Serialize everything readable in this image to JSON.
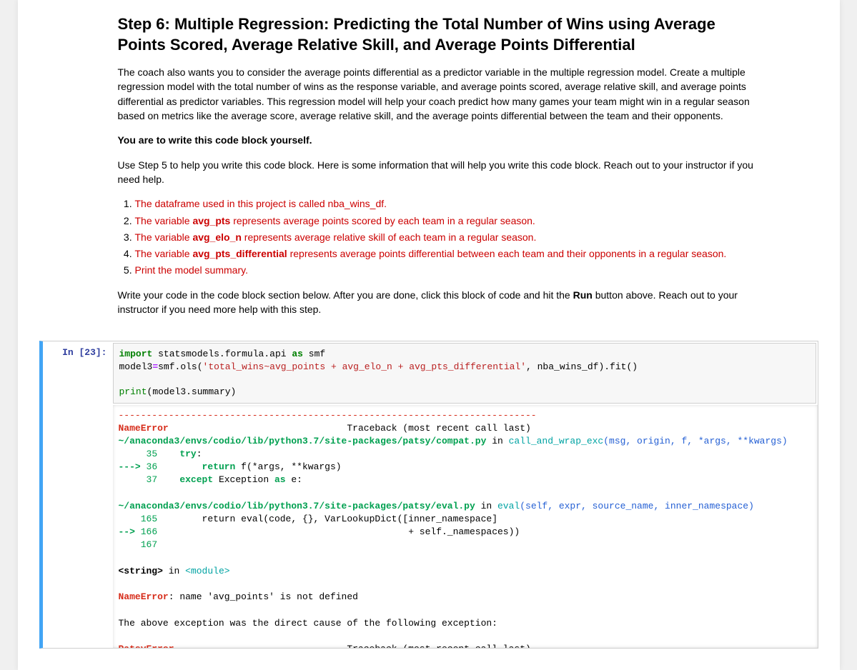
{
  "heading": "Step 6: Multiple Regression: Predicting the Total Number of Wins using Average Points Scored, Average Relative Skill, and Average Points Differential",
  "para1": "The coach also wants you to consider the average points differential as a predictor variable in the multiple regression model. Create a multiple regression model with the total number of wins as the response variable, and average points scored, average relative skill, and average points differential as predictor variables. This regression model will help your coach predict how many games your team might win in a regular season based on metrics like the average score, average relative skill, and the average points differential between the team and their opponents.",
  "para2_bold": "You are to write this code block yourself.",
  "para3": "Use Step 5 to help you write this code block. Here is some information that will help you write this code block. Reach out to your instructor if you need help.",
  "list": {
    "i1": "The dataframe used in this project is called nba_wins_df.",
    "i2a": "The variable ",
    "i2b": "avg_pts",
    "i2c": " represents average points scored by each team in a regular season.",
    "i3a": "The variable ",
    "i3b": "avg_elo_n",
    "i3c": " represents average relative skill of each team in a regular season.",
    "i4a": "The variable ",
    "i4b": "avg_pts_differential",
    "i4c": " represents average points differential between each team and their opponents in a regular season.",
    "i5": "Print the model summary."
  },
  "para4a": "Write your code in the code block section below. After you are done, click this block of code and hit the ",
  "para4b": "Run",
  "para4c": " button above. Reach out to your instructor if you need more help with this step.",
  "cell": {
    "prompt": "In [23]:",
    "code": {
      "l1_import": "import",
      "l1_mod": " statsmodels.formula.api ",
      "l1_as": "as",
      "l1_alias": " smf",
      "l2_a": "model3",
      "l2_eq": "=",
      "l2_b": "smf.ols(",
      "l2_str": "'total_wins~avg_points + avg_elo_n + avg_pts_differential'",
      "l2_c": ", nba_wins_df).fit()",
      "l3_blank": "",
      "l4_print": "print",
      "l4_open": "(",
      "l4_arg": "model3.summary",
      "l4_close": ")"
    },
    "traceback": {
      "rule": "---------------------------------------------------------------------------",
      "name_error": "NameError",
      "trace_label": "                                Traceback (most recent call last)",
      "file1": "~/anaconda3/envs/codio/lib/python3.7/site-packages/patsy/compat.py",
      "in1": " in ",
      "fn1": "call_and_wrap_exc",
      "sig1": "(msg, origin, f, *args, **kwargs)",
      "l35_num": "     35",
      "l35_try": "    try",
      "l35_colon": ":",
      "l36_arrow": "---> ",
      "l36_num": "36",
      "l36_pad": "        ",
      "l36_return": "return",
      "l36_body": " f(*args, **kwargs)",
      "l37_num": "     37",
      "l37_except": "    except",
      "l37_rest": " Exception ",
      "l37_as": "as",
      "l37_e": " e:",
      "file2": "~/anaconda3/envs/codio/lib/python3.7/site-packages/patsy/eval.py",
      "in2": " in ",
      "fn2": "eval",
      "sig2": "(self, expr, source_name, inner_namespace)",
      "l165_num": "    165",
      "l165_body": "        return eval(code, {}, VarLookupDict([inner_namespace]",
      "l166_arrow": "--> ",
      "l166_num": "166",
      "l166_pad": "                                             ",
      "l166_body": "+ self._namespaces))",
      "l167_num": "    167",
      "string_loc": "<string>",
      "in3": " in ",
      "module": "<module>",
      "ne2": "NameError",
      "ne2_msg": ": name 'avg_points' is not defined",
      "chain": "The above exception was the direct cause of the following exception:",
      "patsy_error": "PatsyError",
      "trace_label2": "                               Traceback (most recent call last)"
    }
  }
}
